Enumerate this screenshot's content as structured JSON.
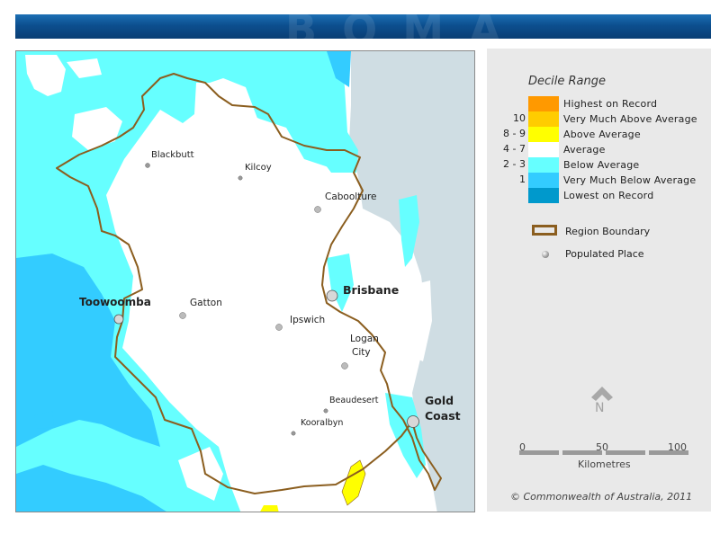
{
  "legend": {
    "title": "Decile Range",
    "rows": [
      {
        "code": "",
        "label": "Highest on Record",
        "color": "#ff9900"
      },
      {
        "code": "10",
        "label": "Very Much Above Average",
        "color": "#ffcc00"
      },
      {
        "code": "8 - 9",
        "label": "Above Average",
        "color": "#ffff00"
      },
      {
        "code": "4 - 7",
        "label": "Average",
        "color": "#ffffff"
      },
      {
        "code": "2 - 3",
        "label": "Below Average",
        "color": "#66ffff"
      },
      {
        "code": "1",
        "label": "Very Much Below Average",
        "color": "#33ccff"
      },
      {
        "code": "",
        "label": "Lowest on Record",
        "color": "#0099cc"
      }
    ],
    "boundary_label": "Region Boundary",
    "place_label": "Populated Place"
  },
  "north": {
    "letter": "N"
  },
  "scale_bar": {
    "ticks": [
      "0",
      "50",
      "100"
    ],
    "unit": "Kilometres"
  },
  "copyright": "© Commonwealth of Australia, 2011",
  "places": [
    {
      "name": "Blackbutt",
      "size": "small"
    },
    {
      "name": "Kilcoy",
      "size": "small"
    },
    {
      "name": "Caboolture",
      "size": "small"
    },
    {
      "name": "Brisbane",
      "size": "large"
    },
    {
      "name": "Toowoomba",
      "size": "large"
    },
    {
      "name": "Gatton",
      "size": "small"
    },
    {
      "name": "Ipswich",
      "size": "small"
    },
    {
      "name": "Logan",
      "size": "small"
    },
    {
      "name": "City",
      "size": "small"
    },
    {
      "name": "Beaudesert",
      "size": "small"
    },
    {
      "name": "Kooralbyn",
      "size": "small"
    },
    {
      "name": "Gold",
      "size": "large"
    },
    {
      "name": "Coast",
      "size": "large"
    }
  ],
  "colors": {
    "sea": "#cfdde3",
    "below_average": "#66ffff",
    "very_much_below": "#33ccff",
    "above_average": "#ffff00",
    "boundary": "#8b5e1f"
  }
}
